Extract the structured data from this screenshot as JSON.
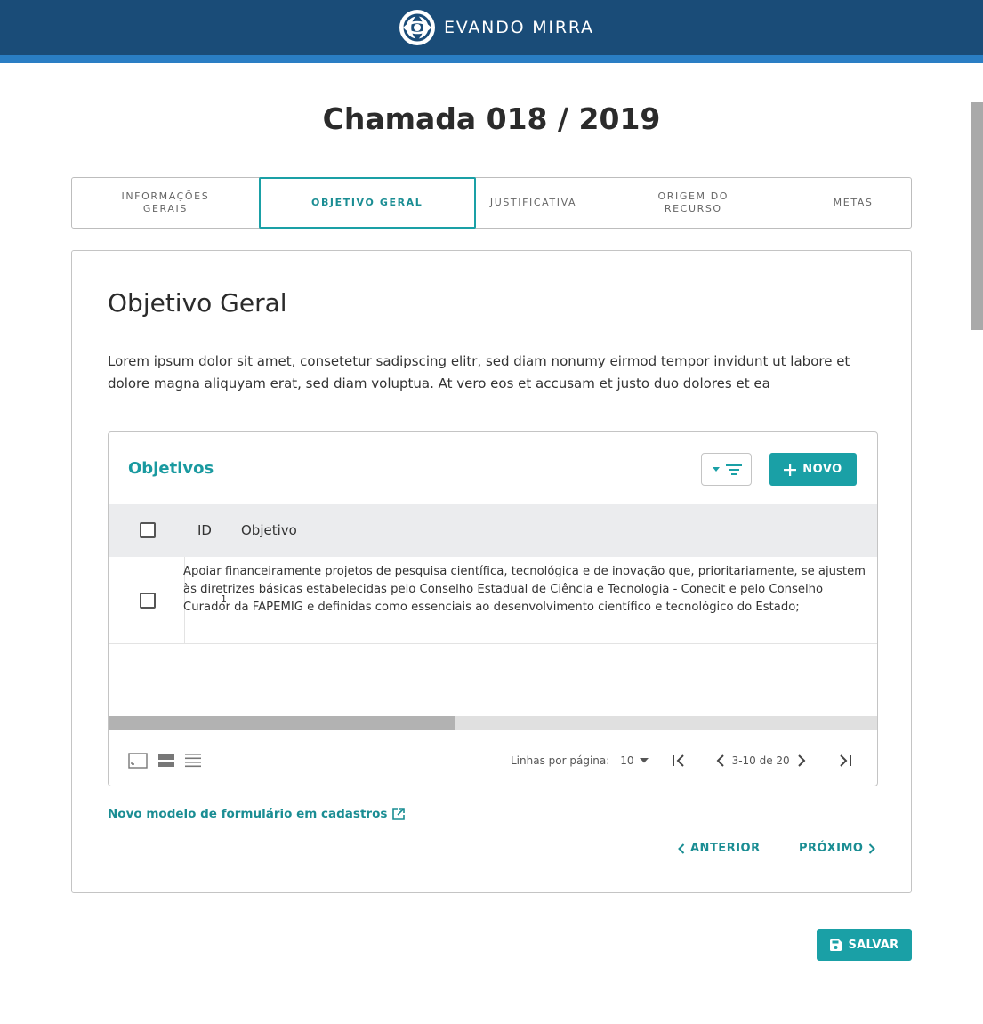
{
  "header": {
    "brand_name": "EVANDO MIRRA",
    "logo_icon": "evando-mirra-logo-icon"
  },
  "page": {
    "title": "Chamada 018 / 2019"
  },
  "tabs": [
    {
      "label": "INFORMAÇÕES GERAIS"
    },
    {
      "label": "OBJETIVO GERAL",
      "active": true
    },
    {
      "label": "JUSTIFICATIVA"
    },
    {
      "label": "ORIGEM DO RECURSO"
    },
    {
      "label": "METAS"
    }
  ],
  "section": {
    "title": "Objetivo Geral",
    "description": "Lorem ipsum dolor sit amet, consetetur sadipscing elitr, sed diam nonumy eirmod tempor invidunt ut labore et dolore magna aliquyam erat, sed diam voluptua. At vero eos et accusam et justo duo dolores et ea"
  },
  "table": {
    "title": "Objetivos",
    "new_button": "NOVO",
    "columns": [
      "ID",
      "Objetivo"
    ],
    "rows": [
      {
        "id": "1",
        "objetivo": "Apoiar financeiramente projetos de pesquisa científica, tecnológica e de inovação que, prioritariamente, se ajustem às diretrizes básicas estabelecidas pelo Conselho Estadual de Ciência e Tecnologia - Conecit e pelo Conselho Curador da FAPEMIG e definidas como essenciais ao desenvolvimento científico e tecnológico do Estado;"
      }
    ],
    "horizontal_scroll_fraction": 0.45,
    "pagination": {
      "rows_per_page_label": "Linhas por página:",
      "rows_per_page_value": "10",
      "range": "3-10 de 20"
    }
  },
  "links": {
    "form_model": "Novo modelo de formulário em cadastros"
  },
  "nav": {
    "previous": "ANTERIOR",
    "next": "PRÓXIMO"
  },
  "actions": {
    "save": "SALVAR"
  },
  "colors": {
    "header": "#1a4c78",
    "header_strip": "#2a7ec4",
    "accent": "#1aa0a6"
  }
}
